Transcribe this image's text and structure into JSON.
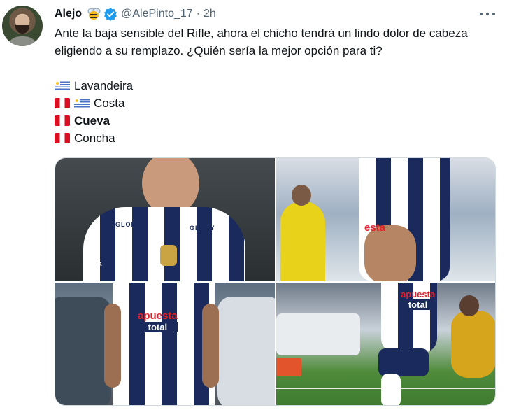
{
  "tweet": {
    "author_name": "Alejo",
    "handle": "@AlePinto_17",
    "separator": "·",
    "time": "2h",
    "text": "Ante la baja sensible del Rifle, ahora el chicho tendrá un lindo dolor de cabeza eligiendo a su remplazo. ¿Quién sería la mejor opción para ti?",
    "options": [
      {
        "flags": [
          "uruguay"
        ],
        "name": "Lavandeira",
        "bold": false
      },
      {
        "flags": [
          "peru",
          "uruguay"
        ],
        "name": "Costa",
        "bold": false
      },
      {
        "flags": [
          "peru"
        ],
        "name": "Cueva",
        "bold": true
      },
      {
        "flags": [
          "peru"
        ],
        "name": "Concha",
        "bold": false
      }
    ]
  },
  "icons": {
    "verified": "verified-badge-icon",
    "emoji": "bee-icon",
    "more": "more-options-icon"
  },
  "photos": {
    "count": 4,
    "sponsor_lines": {
      "photo1_brand": "GLORY",
      "photo1_brand2": "GLORY",
      "photo1_sponsor": "Arica",
      "photo2_sponsor": "esta",
      "photo3_top": "apuesta",
      "photo3_bottom": "total",
      "photo4_top": "apuesta",
      "photo4_bottom": "total"
    }
  },
  "colors": {
    "text": "#0f1419",
    "secondary": "#536471",
    "verified": "#1d9bf0",
    "peru_red": "#d91023",
    "uruguay_blue": "#4a72c6"
  }
}
